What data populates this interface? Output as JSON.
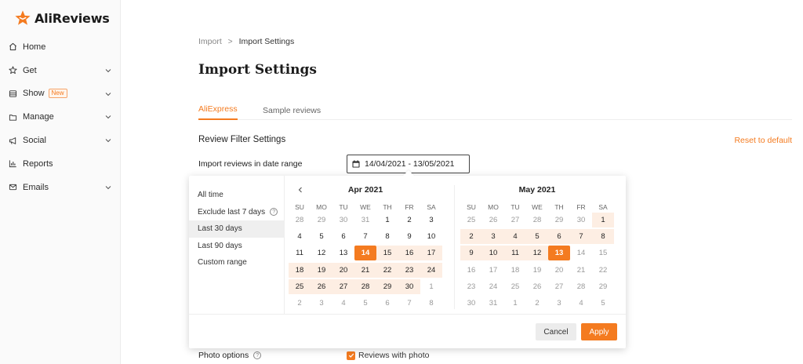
{
  "app": {
    "name": "AliReviews",
    "accent": "#f47b20"
  },
  "sidebar": {
    "items": [
      {
        "label": "Home",
        "icon": "home-icon",
        "chevron": false
      },
      {
        "label": "Get",
        "icon": "star-icon",
        "chevron": true
      },
      {
        "label": "Show",
        "icon": "layout-icon",
        "chevron": true,
        "badge": "New"
      },
      {
        "label": "Manage",
        "icon": "folder-icon",
        "chevron": true
      },
      {
        "label": "Social",
        "icon": "megaphone-icon",
        "chevron": true
      },
      {
        "label": "Reports",
        "icon": "bar-chart-icon",
        "chevron": false
      },
      {
        "label": "Emails",
        "icon": "mail-icon",
        "chevron": true
      }
    ]
  },
  "breadcrumb": {
    "parent": "Import",
    "separator": ">",
    "current": "Import Settings"
  },
  "page_title": "Import Settings",
  "tabs": [
    {
      "label": "AliExpress",
      "active": true
    },
    {
      "label": "Sample reviews",
      "active": false
    }
  ],
  "filter": {
    "section_title": "Review Filter Settings",
    "reset_label": "Reset to default",
    "date_label": "Import reviews in date range",
    "date_value": "14/04/2021 - 13/05/2021"
  },
  "picker": {
    "presets": [
      {
        "label": "All time",
        "help": false,
        "active": false
      },
      {
        "label": "Exclude last 7 days",
        "help": true,
        "active": false
      },
      {
        "label": "Last 30 days",
        "help": false,
        "active": true
      },
      {
        "label": "Last 90 days",
        "help": false,
        "active": false
      },
      {
        "label": "Custom range",
        "help": false,
        "active": false
      }
    ],
    "weekdays": [
      "SU",
      "MO",
      "TU",
      "WE",
      "TH",
      "FR",
      "SA"
    ],
    "months": [
      {
        "title": "Apr 2021",
        "weeks": [
          [
            {
              "d": "28",
              "m": 1
            },
            {
              "d": "29",
              "m": 1
            },
            {
              "d": "30",
              "m": 1
            },
            {
              "d": "31",
              "m": 1
            },
            {
              "d": "1"
            },
            {
              "d": "2"
            },
            {
              "d": "3"
            }
          ],
          [
            {
              "d": "4"
            },
            {
              "d": "5"
            },
            {
              "d": "6"
            },
            {
              "d": "7"
            },
            {
              "d": "8"
            },
            {
              "d": "9"
            },
            {
              "d": "10"
            }
          ],
          [
            {
              "d": "11"
            },
            {
              "d": "12"
            },
            {
              "d": "13"
            },
            {
              "d": "14",
              "s": 1
            },
            {
              "d": "15",
              "r": 1
            },
            {
              "d": "16",
              "r": 1
            },
            {
              "d": "17",
              "r": 1
            }
          ],
          [
            {
              "d": "18",
              "r": 1
            },
            {
              "d": "19",
              "r": 1
            },
            {
              "d": "20",
              "r": 1
            },
            {
              "d": "21",
              "r": 1
            },
            {
              "d": "22",
              "r": 1
            },
            {
              "d": "23",
              "r": 1
            },
            {
              "d": "24",
              "r": 1
            }
          ],
          [
            {
              "d": "25",
              "r": 1
            },
            {
              "d": "26",
              "r": 1
            },
            {
              "d": "27",
              "r": 1
            },
            {
              "d": "28",
              "r": 1
            },
            {
              "d": "29",
              "r": 1
            },
            {
              "d": "30",
              "r": 1
            },
            {
              "d": "1",
              "m": 1
            }
          ],
          [
            {
              "d": "2",
              "m": 1
            },
            {
              "d": "3",
              "m": 1
            },
            {
              "d": "4",
              "m": 1
            },
            {
              "d": "5",
              "m": 1
            },
            {
              "d": "6",
              "m": 1
            },
            {
              "d": "7",
              "m": 1
            },
            {
              "d": "8",
              "m": 1
            }
          ]
        ]
      },
      {
        "title": "May 2021",
        "weeks": [
          [
            {
              "d": "25",
              "m": 1
            },
            {
              "d": "26",
              "m": 1
            },
            {
              "d": "27",
              "m": 1
            },
            {
              "d": "28",
              "m": 1
            },
            {
              "d": "29",
              "m": 1
            },
            {
              "d": "30",
              "m": 1
            },
            {
              "d": "1",
              "r": 1
            }
          ],
          [
            {
              "d": "2",
              "r": 1
            },
            {
              "d": "3",
              "r": 1
            },
            {
              "d": "4",
              "r": 1
            },
            {
              "d": "5",
              "r": 1
            },
            {
              "d": "6",
              "r": 1
            },
            {
              "d": "7",
              "r": 1
            },
            {
              "d": "8",
              "r": 1
            }
          ],
          [
            {
              "d": "9",
              "r": 1
            },
            {
              "d": "10",
              "r": 1
            },
            {
              "d": "11",
              "r": 1
            },
            {
              "d": "12",
              "r": 1
            },
            {
              "d": "13",
              "s": 1
            },
            {
              "d": "14",
              "m": 1
            },
            {
              "d": "15",
              "m": 1
            }
          ],
          [
            {
              "d": "16",
              "m": 1
            },
            {
              "d": "17",
              "m": 1
            },
            {
              "d": "18",
              "m": 1
            },
            {
              "d": "19",
              "m": 1
            },
            {
              "d": "20",
              "m": 1
            },
            {
              "d": "21",
              "m": 1
            },
            {
              "d": "22",
              "m": 1
            }
          ],
          [
            {
              "d": "23",
              "m": 1
            },
            {
              "d": "24",
              "m": 1
            },
            {
              "d": "25",
              "m": 1
            },
            {
              "d": "26",
              "m": 1
            },
            {
              "d": "27",
              "m": 1
            },
            {
              "d": "28",
              "m": 1
            },
            {
              "d": "29",
              "m": 1
            }
          ],
          [
            {
              "d": "30",
              "m": 1
            },
            {
              "d": "31",
              "m": 1
            },
            {
              "d": "1",
              "m": 1
            },
            {
              "d": "2",
              "m": 1
            },
            {
              "d": "3",
              "m": 1
            },
            {
              "d": "4",
              "m": 1
            },
            {
              "d": "5",
              "m": 1
            }
          ]
        ]
      }
    ],
    "cancel_label": "Cancel",
    "apply_label": "Apply"
  },
  "photo": {
    "label": "Photo options",
    "option_label": "Reviews with photo",
    "checked": true
  }
}
